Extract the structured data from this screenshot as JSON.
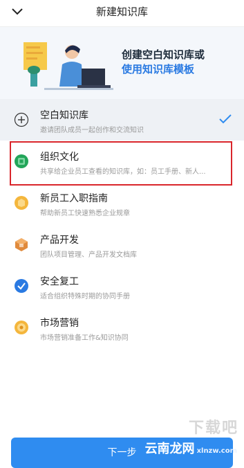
{
  "header": {
    "title": "新建知识库"
  },
  "banner": {
    "line1": "创建空白知识库或",
    "line2": "使用知识库模板"
  },
  "items": [
    {
      "name": "空白知识库",
      "desc": "邀请团队成员一起创作和交流知识",
      "icon": "plus-icon",
      "selected": true
    },
    {
      "name": "组织文化",
      "desc": "共享给企业员工查看的知识库，如：员工手册、新人...",
      "icon": "culture-icon",
      "color": "#22a559"
    },
    {
      "name": "新员工入职指南",
      "desc": "帮助新员工快速熟悉企业规章",
      "icon": "guide-icon",
      "color": "#f4b63c"
    },
    {
      "name": "产品开发",
      "desc": "团队项目管理、产品开发文档库",
      "icon": "product-icon",
      "color": "#e08a3c"
    },
    {
      "name": "安全复工",
      "desc": "适合组织特殊时期的协同手册",
      "icon": "safety-icon",
      "color": "#2a7ae2"
    },
    {
      "name": "市场营销",
      "desc": "市场营销准备工作&知识协同",
      "icon": "marketing-icon",
      "color": "#f4b63c"
    }
  ],
  "footer": {
    "next_label": "下一步"
  },
  "watermark": {
    "text1": "下载吧",
    "text2": "云南龙网",
    "text3": "xlnzw.com"
  },
  "colors": {
    "accent": "#2f8cf0",
    "highlight": "#d9252b"
  }
}
